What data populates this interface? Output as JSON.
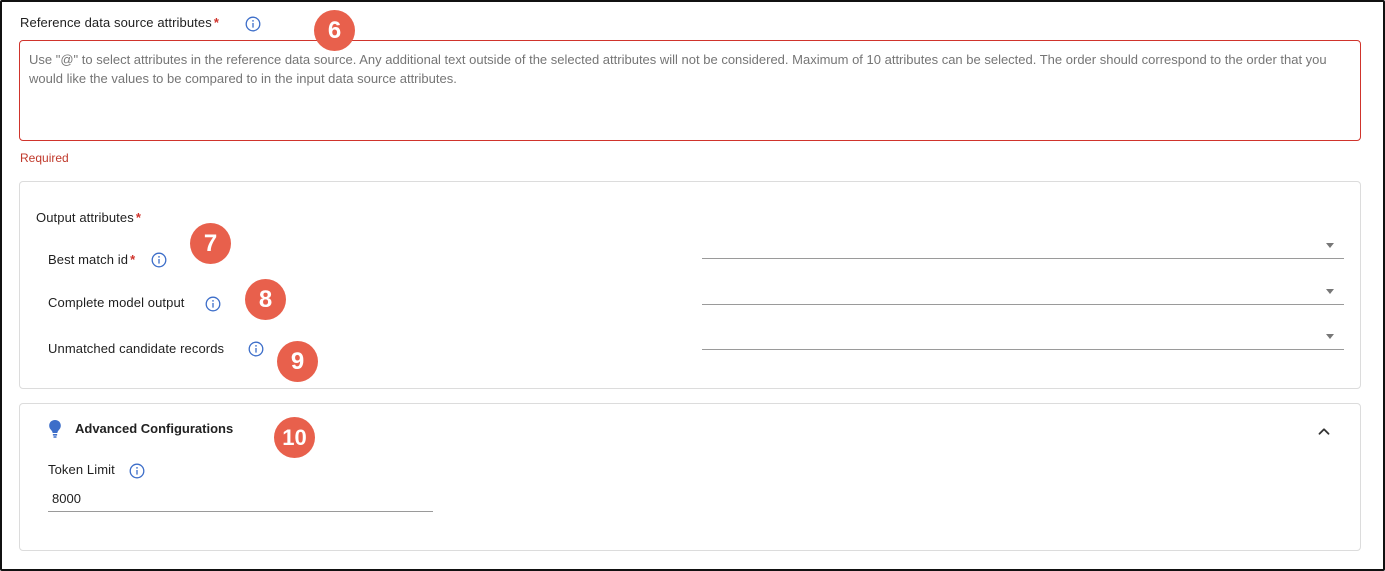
{
  "reference": {
    "label": "Reference data source attributes",
    "required_mark": "*",
    "placeholder": "Use \"@\" to select attributes in the reference data source. Any additional text outside of the selected attributes will not be considered. Maximum of 10 attributes can be selected. The order should correspond to the order that you would like the values to be compared to in the input data source attributes.",
    "error": "Required"
  },
  "output": {
    "label": "Output attributes",
    "required_mark": "*",
    "fields": [
      {
        "label": "Best match id",
        "required_mark": "*",
        "value": ""
      },
      {
        "label": "Complete model output",
        "value": ""
      },
      {
        "label": "Unmatched candidate records",
        "value": ""
      }
    ]
  },
  "advanced": {
    "title": "Advanced Configurations",
    "icon": "lightbulb-icon",
    "token_limit_label": "Token Limit",
    "token_limit_value": "8000"
  },
  "badges": [
    "6",
    "7",
    "8",
    "9",
    "10"
  ],
  "colors": {
    "accent": "#3d6ec9",
    "error": "#d0342c",
    "badge": "#e8604c"
  }
}
